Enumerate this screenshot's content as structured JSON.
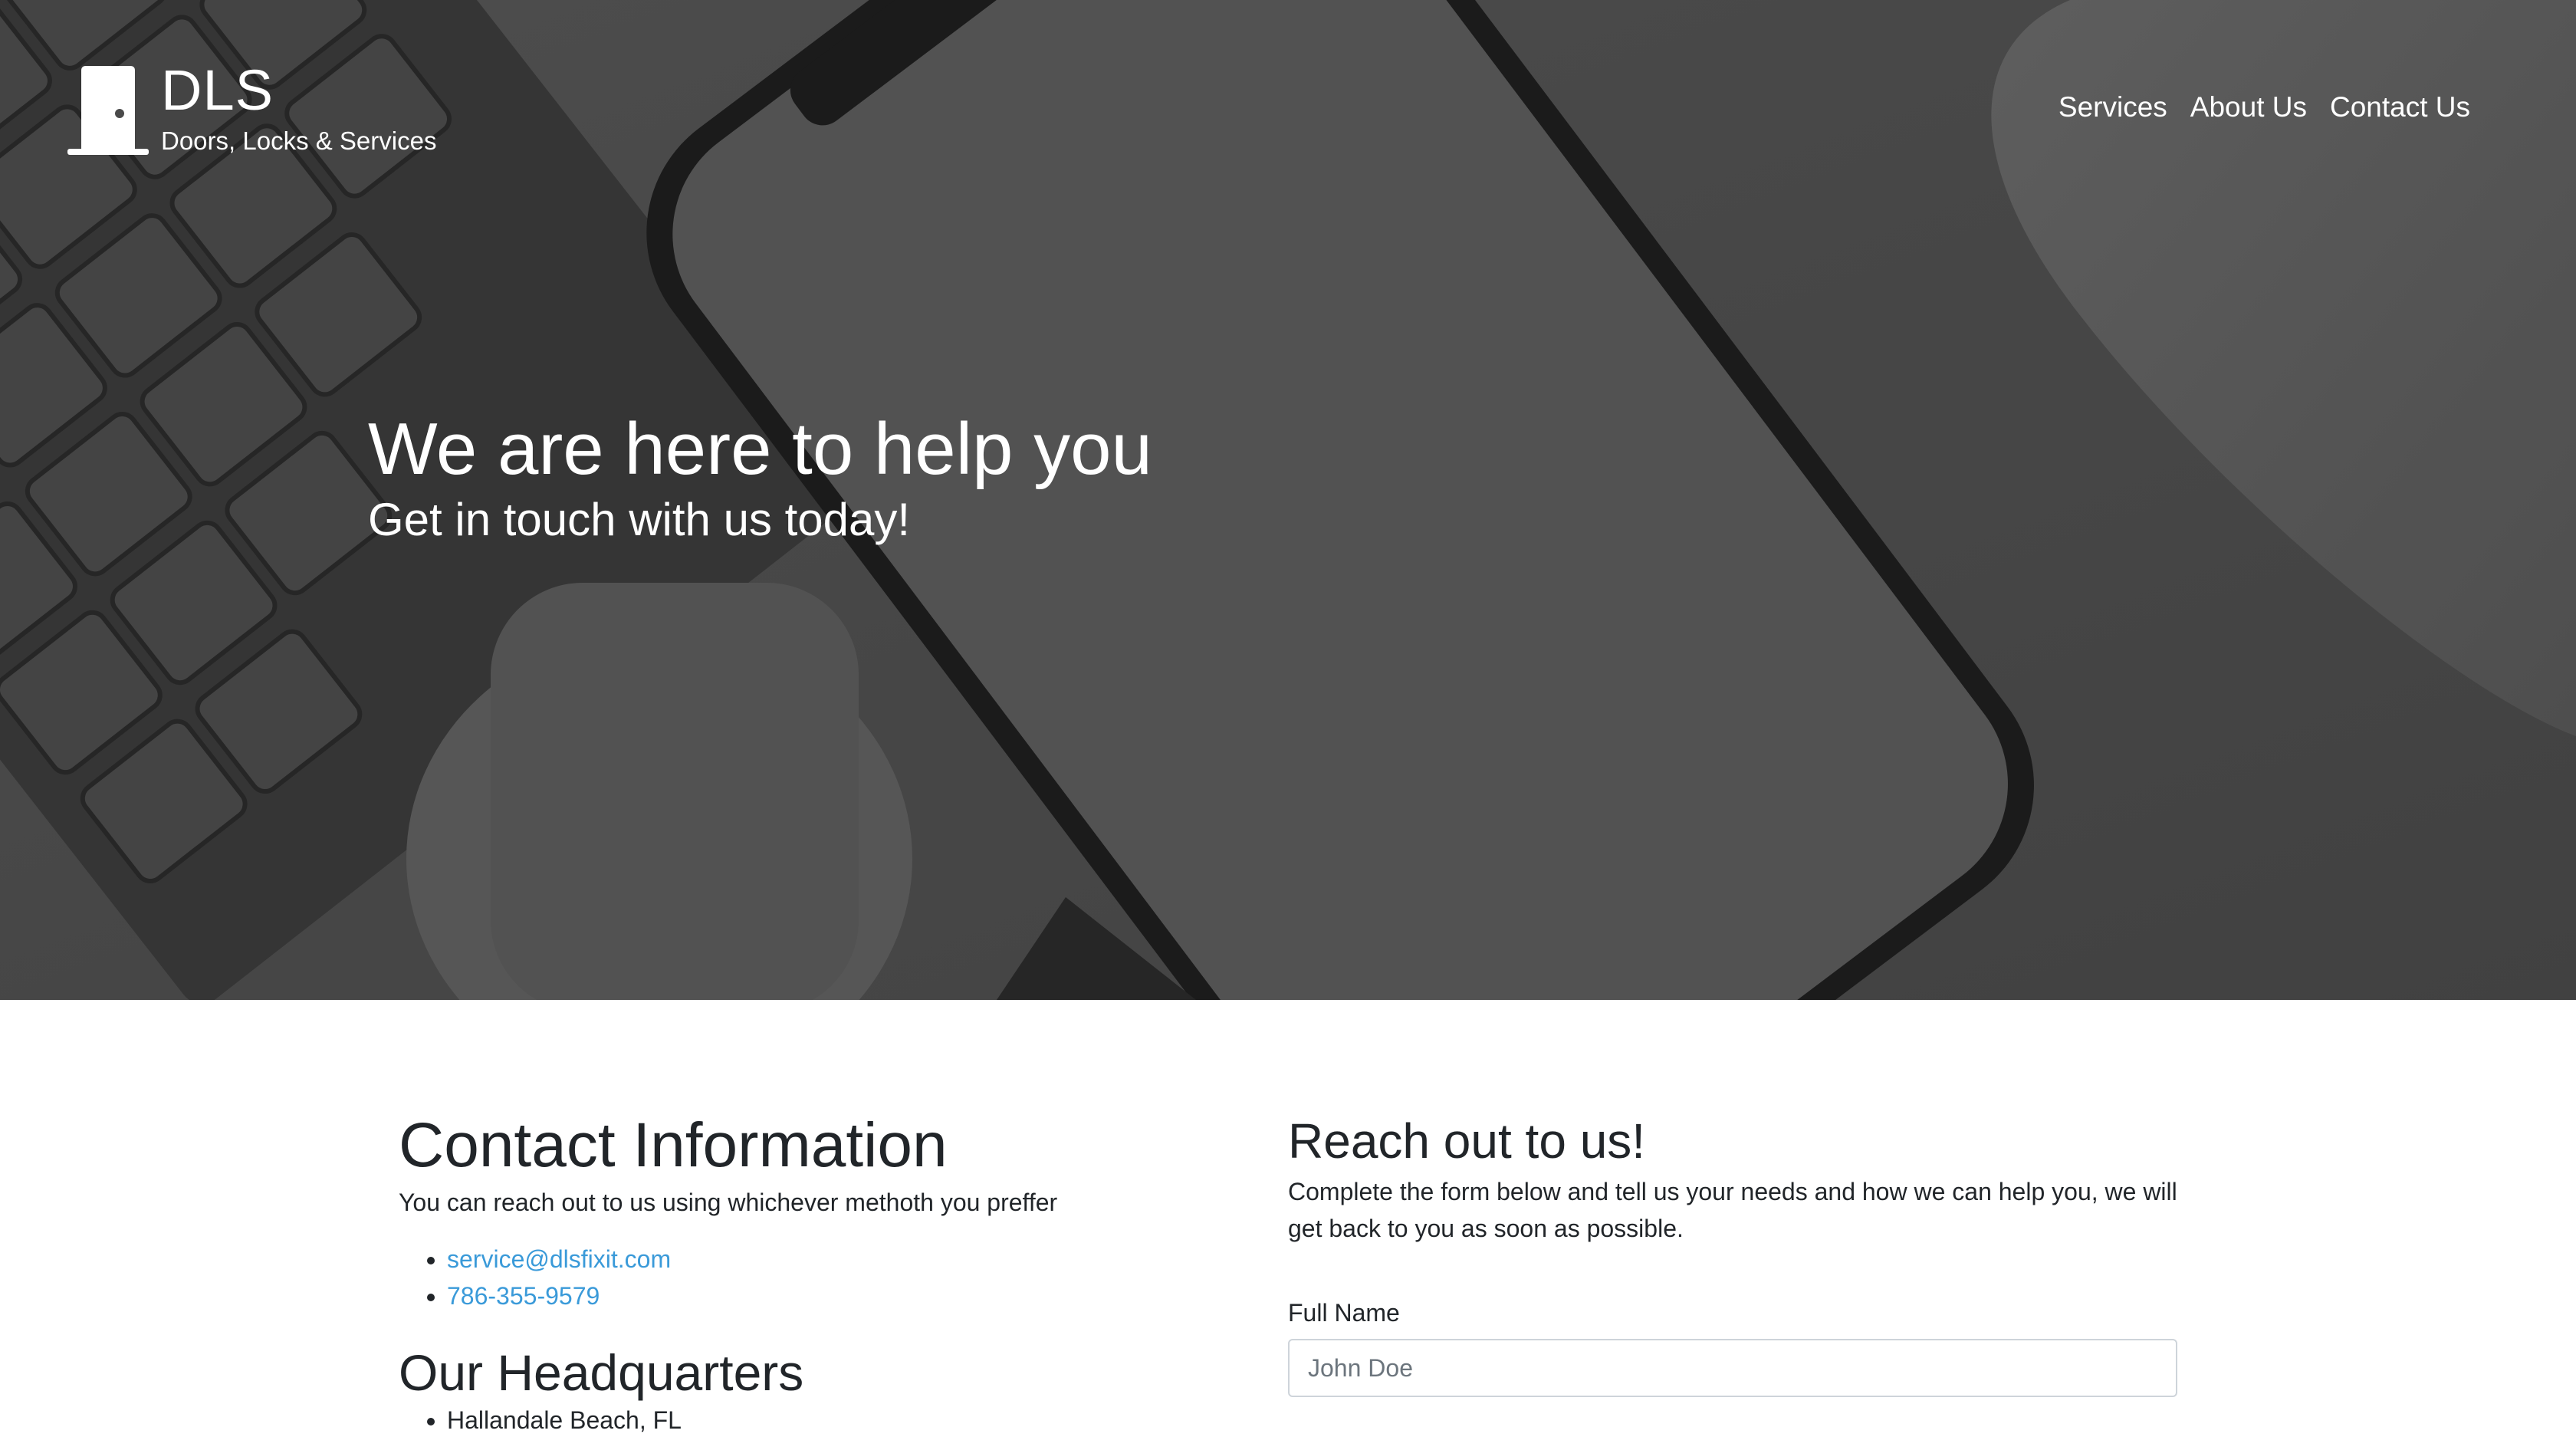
{
  "brand": {
    "name": "DLS",
    "tagline": "Doors, Locks & Services"
  },
  "nav": {
    "items": [
      {
        "label": "Services"
      },
      {
        "label": "About Us"
      },
      {
        "label": "Contact Us"
      }
    ]
  },
  "hero": {
    "title": "We are here to help you",
    "subtitle": "Get in touch with us today!"
  },
  "contact_info": {
    "heading": "Contact Information",
    "description": "You can reach out to us using whichever methoth you preffer",
    "email": "service@dlsfixit.com",
    "phone": "786-355-9579",
    "hq_heading": "Our Headquarters",
    "hq_address": "Hallandale Beach, FL"
  },
  "form": {
    "heading": "Reach out to us!",
    "description": "Complete the form below and tell us your needs and how we can help you, we will get back to you as soon as possible.",
    "full_name_label": "Full Name",
    "full_name_placeholder": "John Doe"
  },
  "colors": {
    "link": "#3a9ad9",
    "text": "#212529",
    "hero_text": "#ffffff"
  }
}
